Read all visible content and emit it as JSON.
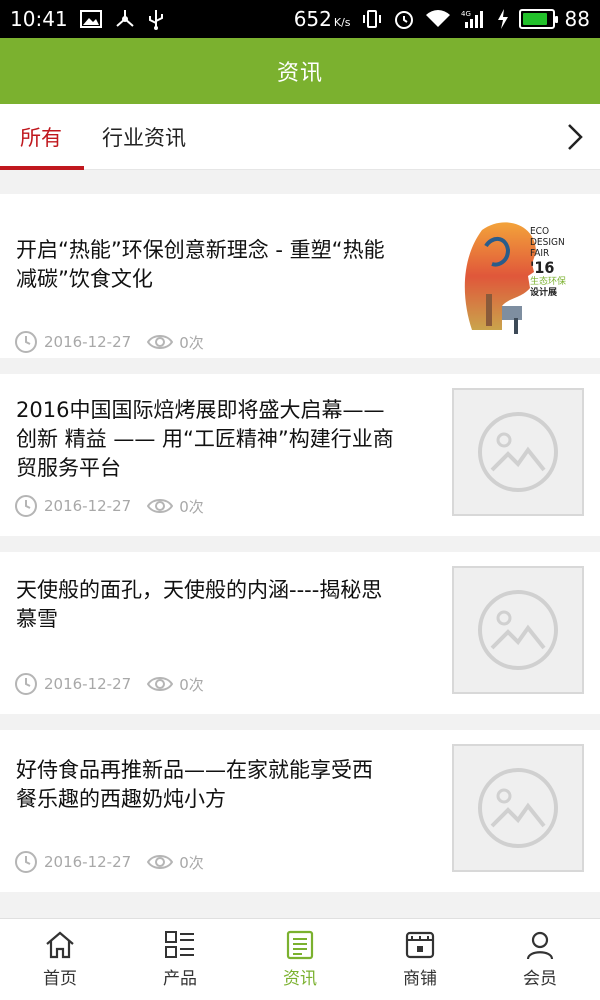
{
  "status_bar": {
    "time": "10:41",
    "speed": "652",
    "speed_unit": "K/s",
    "network": "4G",
    "battery": "88",
    "battery_level": 0.88
  },
  "header": {
    "title": "资讯"
  },
  "tabs": [
    {
      "label": "所有",
      "active": true
    },
    {
      "label": "行业资讯",
      "active": false
    }
  ],
  "articles": [
    {
      "title_lines": [
        "开启“热能”环保创意新理念 - 重塑“热能",
        "减碳”饮食文化"
      ],
      "date": "2016-12-27",
      "views": "0次",
      "thumb": "poster"
    },
    {
      "title_lines": [
        "2016中国国际焙烤展即将盛大启幕——",
        "创新 精益 —— 用“工匠精神”构建行业商",
        "贸服务平台"
      ],
      "date": "2016-12-27",
      "views": "0次",
      "thumb": "placeholder"
    },
    {
      "title_lines": [
        "天使般的面孔，天使般的内涵----揭秘思",
        "慕雪"
      ],
      "date": "2016-12-27",
      "views": "0次",
      "thumb": "placeholder"
    },
    {
      "title_lines": [
        "好侍食品再推新品——在家就能享受西",
        "餐乐趣的西趣奶炖小方"
      ],
      "date": "2016-12-27",
      "views": "0次",
      "thumb": "placeholder"
    }
  ],
  "poster_text": {
    "eco": "ECO",
    "design": "DESIGN",
    "fair": "FAIR",
    "year": "'16",
    "cn1": "生态环保",
    "cn2": "设计展"
  },
  "bottom_nav": [
    {
      "label": "首页",
      "icon": "home-icon",
      "active": false
    },
    {
      "label": "产品",
      "icon": "grid-list-icon",
      "active": false
    },
    {
      "label": "资讯",
      "icon": "news-icon",
      "active": true
    },
    {
      "label": "商铺",
      "icon": "store-icon",
      "active": false
    },
    {
      "label": "会员",
      "icon": "user-icon",
      "active": false
    }
  ],
  "colors": {
    "brand_green": "#7bb12f",
    "tab_active_red": "#c0181e"
  }
}
